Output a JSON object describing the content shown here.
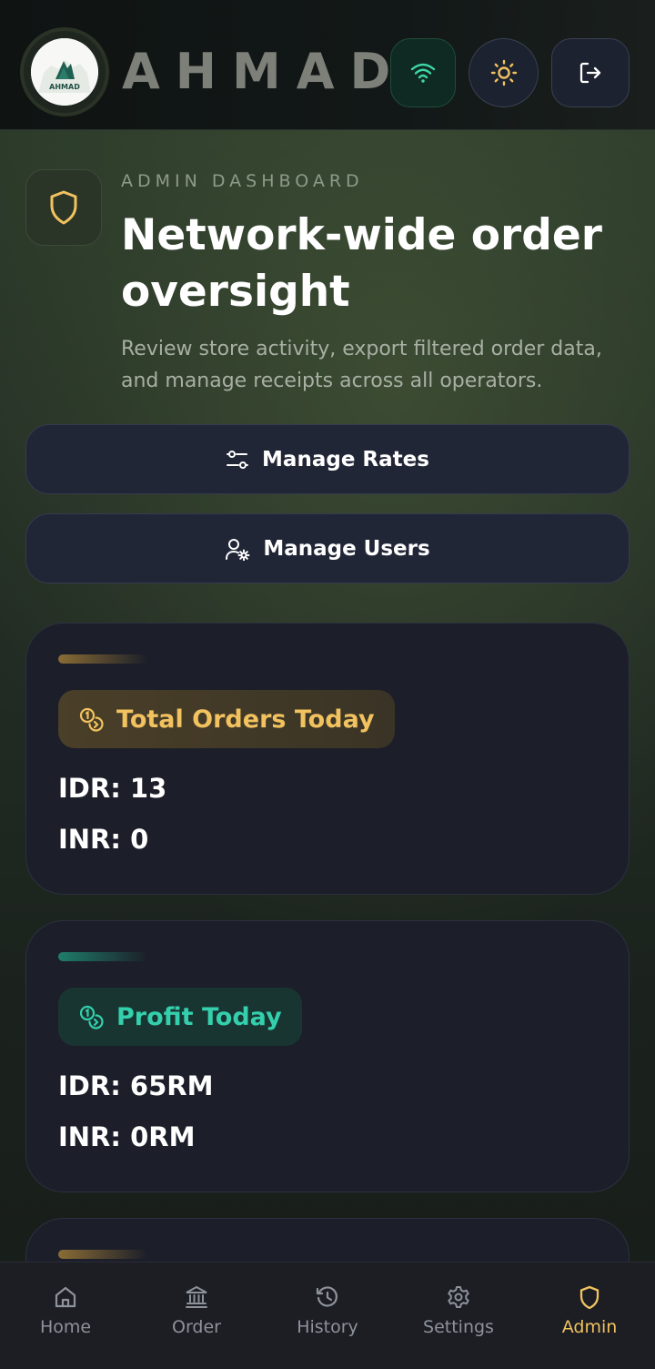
{
  "header": {
    "brand": "AHMAD",
    "logo_text": "AHMAD",
    "icons": {
      "wifi": "wifi-icon",
      "theme": "sun-icon",
      "logout": "logout-icon"
    }
  },
  "hero": {
    "eyebrow": "ADMIN DASHBOARD",
    "title": "Network-wide order oversight",
    "subtitle": "Review store activity, export filtered order data, and manage receipts across all operators."
  },
  "actions": {
    "manage_rates": "Manage Rates",
    "manage_users": "Manage Users"
  },
  "cards": {
    "orders": {
      "label": "Total Orders Today",
      "lines": [
        "IDR: 13",
        "INR: 0"
      ]
    },
    "profit": {
      "label": "Profit Today",
      "lines": [
        "IDR: 65RM",
        "INR: 0RM"
      ]
    }
  },
  "nav": {
    "items": [
      {
        "label": "Home",
        "icon": "home-icon"
      },
      {
        "label": "Order",
        "icon": "bank-icon"
      },
      {
        "label": "History",
        "icon": "history-icon"
      },
      {
        "label": "Settings",
        "icon": "gear-icon"
      },
      {
        "label": "Admin",
        "icon": "shield-icon"
      }
    ],
    "active": "Admin"
  },
  "colors": {
    "accent_gold": "#f1c25f",
    "accent_teal": "#34cfac",
    "card_bg": "#1c1f29",
    "button_bg": "#212637"
  }
}
